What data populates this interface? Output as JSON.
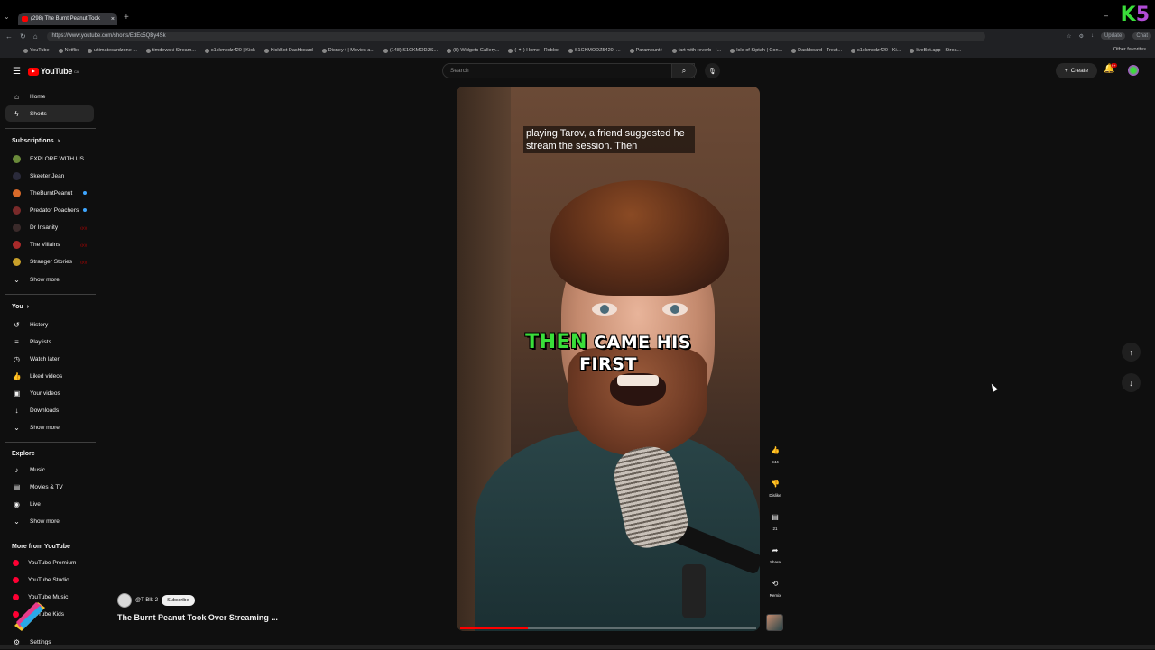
{
  "browser": {
    "tab_title": "(298) The Burnt Peanut Took",
    "url": "https://www.youtube.com/shorts/EdEc5QBy4Sk",
    "update_label": "Update",
    "chat_label": "Chat",
    "bookmarks": [
      "YouTube",
      "Netflix",
      "ultimatecardzone ...",
      "timdewski Stream...",
      "s1ckmodz420 | Kick",
      "KickBot Dashboard",
      "Disney+ | Movies a...",
      "(148) S1CKMODZS...",
      "(8) Widgets Gallery...",
      "( ✦ ) Home - Roblox",
      "S1CKMODZ5420 -...",
      "Paramount+",
      "fart with reverb - I...",
      "Isle of Siptah | Con...",
      "Dashboard - Treat...",
      "s1ckmodz420 - Ki...",
      "liveBot.app - Strea..."
    ],
    "other_favorites": "Other favorites"
  },
  "header": {
    "logo_text": "YouTube",
    "logo_region": "CA",
    "search_placeholder": "Search",
    "create_label": "Create",
    "notif_count": "9+"
  },
  "sidebar": {
    "top": [
      {
        "label": "Home",
        "icon": "home-icon"
      },
      {
        "label": "Shorts",
        "icon": "shorts-icon",
        "active": true
      }
    ],
    "subscriptions_title": "Subscriptions",
    "subscriptions": [
      {
        "label": "EXPLORE WITH US",
        "color": "#6a8a3a"
      },
      {
        "label": "Skeeter Jean",
        "color": "#2a2a3a"
      },
      {
        "label": "TheBurntPeanut",
        "color": "#d86a2a"
      },
      {
        "label": "Predator Poachers",
        "color": "#7a2a2a"
      },
      {
        "label": "Dr Insanity",
        "color": "#3a2a2a"
      },
      {
        "label": "The Villains",
        "color": "#aa2a2a"
      },
      {
        "label": "Stranger Stories",
        "color": "#c8a02a"
      }
    ],
    "show_more": "Show more",
    "you_title": "You",
    "you_items": [
      {
        "label": "History",
        "icon": "history-icon"
      },
      {
        "label": "Playlists",
        "icon": "playlists-icon"
      },
      {
        "label": "Watch later",
        "icon": "watch-later-icon"
      },
      {
        "label": "Liked videos",
        "icon": "like-icon"
      },
      {
        "label": "Your videos",
        "icon": "your-videos-icon"
      },
      {
        "label": "Downloads",
        "icon": "download-icon"
      }
    ],
    "explore_title": "Explore",
    "explore_items": [
      {
        "label": "Music",
        "icon": "music-icon"
      },
      {
        "label": "Movies & TV",
        "icon": "movies-icon"
      },
      {
        "label": "Live",
        "icon": "live-icon"
      }
    ],
    "more_title": "More from YouTube",
    "more_items": [
      {
        "label": "YouTube Premium"
      },
      {
        "label": "YouTube Studio"
      },
      {
        "label": "YouTube Music"
      },
      {
        "label": "YouTube Kids"
      }
    ],
    "settings_label": "Settings"
  },
  "video": {
    "caption_top": "playing Tarov, a friend suggested he stream the session. Then",
    "caption_highlight": "THEN",
    "caption_rest_line1": "CAME HIS",
    "caption_line2": "FIRST",
    "progress": 0.23
  },
  "actions": {
    "like_count": "944",
    "dislike_label": "Dislike",
    "comment_count": "21",
    "share_label": "Share",
    "remix_label": "Remix"
  },
  "channel": {
    "handle": "@T-Blk-2",
    "subscribe_label": "Subscribe",
    "title": "The Burnt Peanut Took Over Streaming ..."
  },
  "colors": {
    "accent_red": "#ff0000",
    "caption_green": "#3ade3a"
  }
}
